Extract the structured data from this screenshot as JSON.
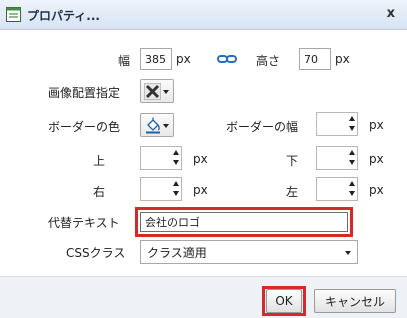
{
  "dialog": {
    "title": "プロパティ...",
    "close_label": "x"
  },
  "form": {
    "width_label": "幅",
    "width_value": "385",
    "width_unit": "px",
    "height_label": "高さ",
    "height_value": "70",
    "height_unit": "px",
    "link_icon": "link-icon",
    "align_label": "画像配置指定",
    "align_icon": "no-align-icon",
    "border_color_label": "ボーダーの色",
    "border_color_icon": "paint-bucket-icon",
    "border_width_label": "ボーダーの幅",
    "border_width_unit": "px",
    "top_label": "上",
    "top_unit": "px",
    "bottom_label": "下",
    "bottom_unit": "px",
    "right_label": "右",
    "right_unit": "px",
    "left_label": "左",
    "left_unit": "px",
    "alt_label": "代替テキスト",
    "alt_value": "会社のロゴ",
    "css_label": "CSSクラス",
    "css_value": "クラス適用"
  },
  "footer": {
    "ok_label": "OK",
    "cancel_label": "キャンセル"
  },
  "colors": {
    "highlight": "#d62a2a",
    "titlebar": "#d8e3f3"
  }
}
